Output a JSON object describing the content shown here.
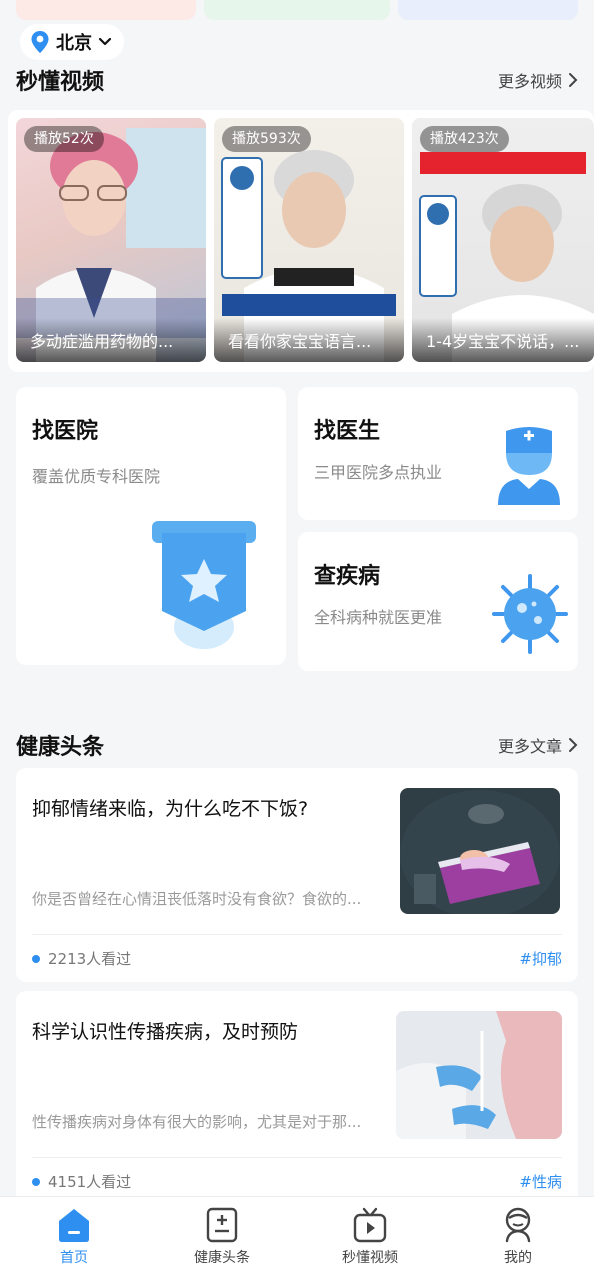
{
  "location": {
    "city": "北京"
  },
  "videos_section": {
    "title": "秒懂视频",
    "more": "更多视频",
    "items": [
      {
        "plays": "播放52次",
        "caption": "多动症滥用药物的..."
      },
      {
        "plays": "播放593次",
        "caption": "看看你家宝宝语言..."
      },
      {
        "plays": "播放423次",
        "caption": "1-4岁宝宝不说话，..."
      }
    ]
  },
  "services": {
    "hospital": {
      "title": "找医院",
      "subtitle": "覆盖优质专科医院"
    },
    "doctor": {
      "title": "找医生",
      "subtitle": "三甲医院多点执业"
    },
    "disease": {
      "title": "查疾病",
      "subtitle": "全科病种就医更准"
    }
  },
  "news_section": {
    "title": "健康头条",
    "more": "更多文章",
    "articles": [
      {
        "title": "抑郁情绪来临，为什么吃不下饭?",
        "desc": "你是否曾经在心情沮丧低落时没有食欲？食欲的...",
        "views": "2213人看过",
        "tag": "#抑郁"
      },
      {
        "title": "科学认识性传播疾病，及时预防",
        "desc": "性传播疾病对身体有很大的影响，尤其是对于那...",
        "views": "4151人看过",
        "tag": "#性病"
      }
    ]
  },
  "tabs": [
    {
      "label": "首页",
      "icon": "home-icon",
      "active": true
    },
    {
      "label": "健康头条",
      "icon": "news-icon",
      "active": false
    },
    {
      "label": "秒懂视频",
      "icon": "video-tv-icon",
      "active": false
    },
    {
      "label": "我的",
      "icon": "profile-icon",
      "active": false
    }
  ],
  "colors": {
    "accent": "#2f8ff0",
    "background": "#f5f6f8"
  }
}
